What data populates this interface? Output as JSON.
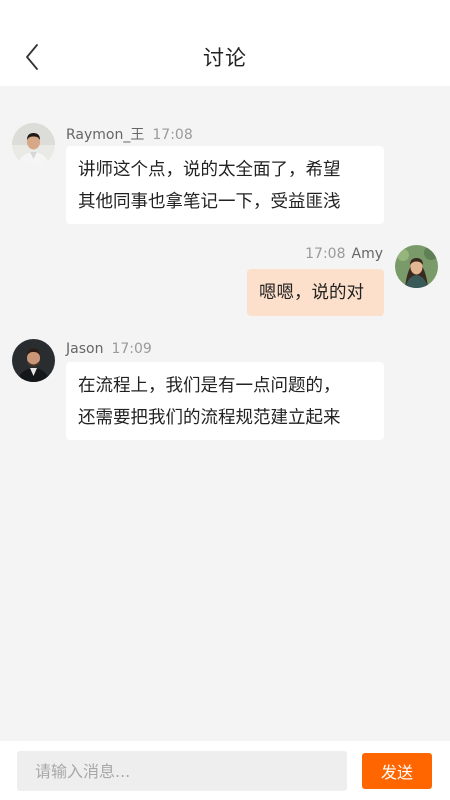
{
  "header": {
    "title": "讨论"
  },
  "messages": [
    {
      "sender": "Raymon_王",
      "time": "17:08",
      "lines": [
        "讲师这个点，说的太全面了，希望",
        "其他同事也拿笔记一下，受益匪浅"
      ]
    },
    {
      "sender": "Amy",
      "time": "17:08",
      "lines": [
        "嗯嗯，说的对"
      ]
    },
    {
      "sender": "Jason",
      "time": "17:09",
      "lines": [
        "在流程上，我们是有一点问题的，",
        "还需要把我们的流程规范建立起来"
      ]
    }
  ],
  "composer": {
    "placeholder": "请输入消息...",
    "value": "",
    "send_label": "发送"
  },
  "colors": {
    "accent": "#ff6600",
    "own_bubble": "#fde0cc",
    "background": "#f4f4f4"
  }
}
